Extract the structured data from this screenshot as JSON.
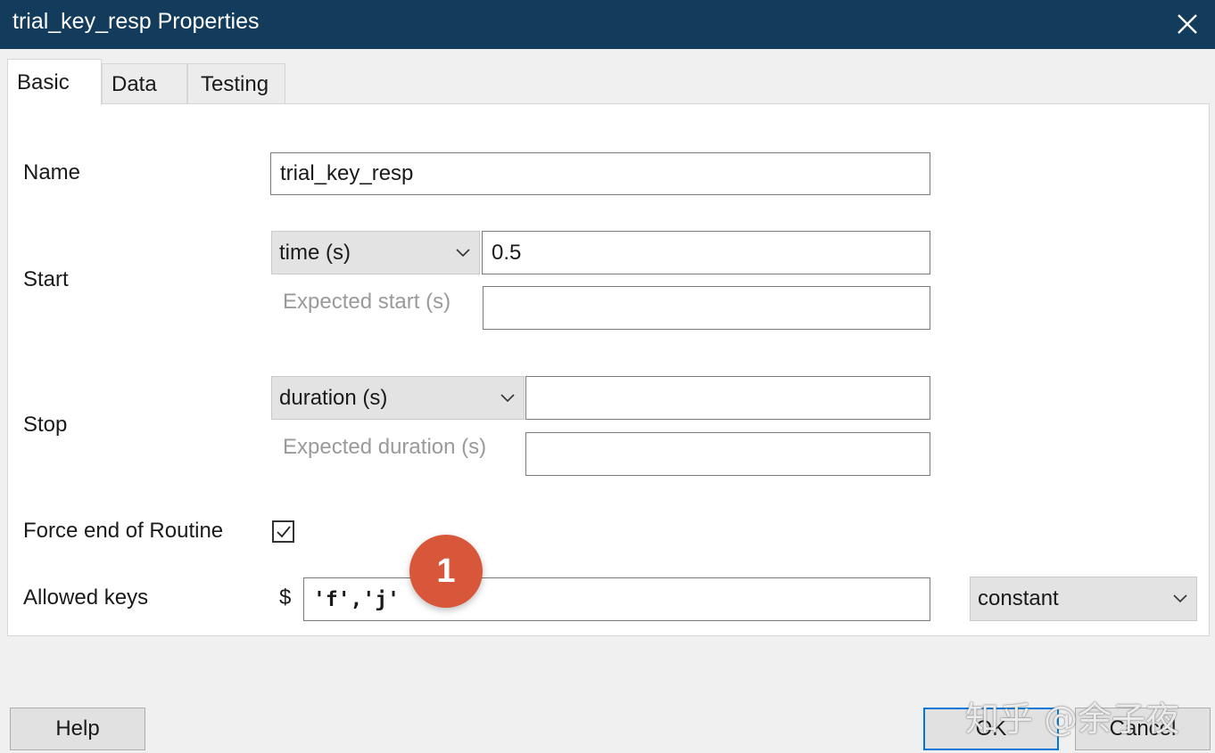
{
  "window": {
    "title": "trial_key_resp Properties",
    "close_icon": "close-icon",
    "title_bar_color": "#133c5c"
  },
  "tabs": [
    {
      "label": "Basic",
      "active": true
    },
    {
      "label": "Data",
      "active": false
    },
    {
      "label": "Testing",
      "active": false
    }
  ],
  "form": {
    "name": {
      "label": "Name",
      "value": "trial_key_resp"
    },
    "start": {
      "label": "Start",
      "type_selected": "time (s)",
      "value": "0.5",
      "expected_label": "Expected start (s)",
      "expected_value": ""
    },
    "stop": {
      "label": "Stop",
      "type_selected": "duration (s)",
      "value": "",
      "expected_label": "Expected duration (s)",
      "expected_value": ""
    },
    "force_end": {
      "label": "Force end of Routine",
      "checked": true
    },
    "allowed_keys": {
      "label": "Allowed keys",
      "prefix": "$",
      "value": "'f','j'",
      "update_selected": "constant"
    }
  },
  "annotation": {
    "badge_number": "1",
    "color": "#d8573a"
  },
  "buttons": {
    "help": "Help",
    "ok": "OK",
    "cancel": "Cancel"
  },
  "watermark": "知乎 @余子夜"
}
